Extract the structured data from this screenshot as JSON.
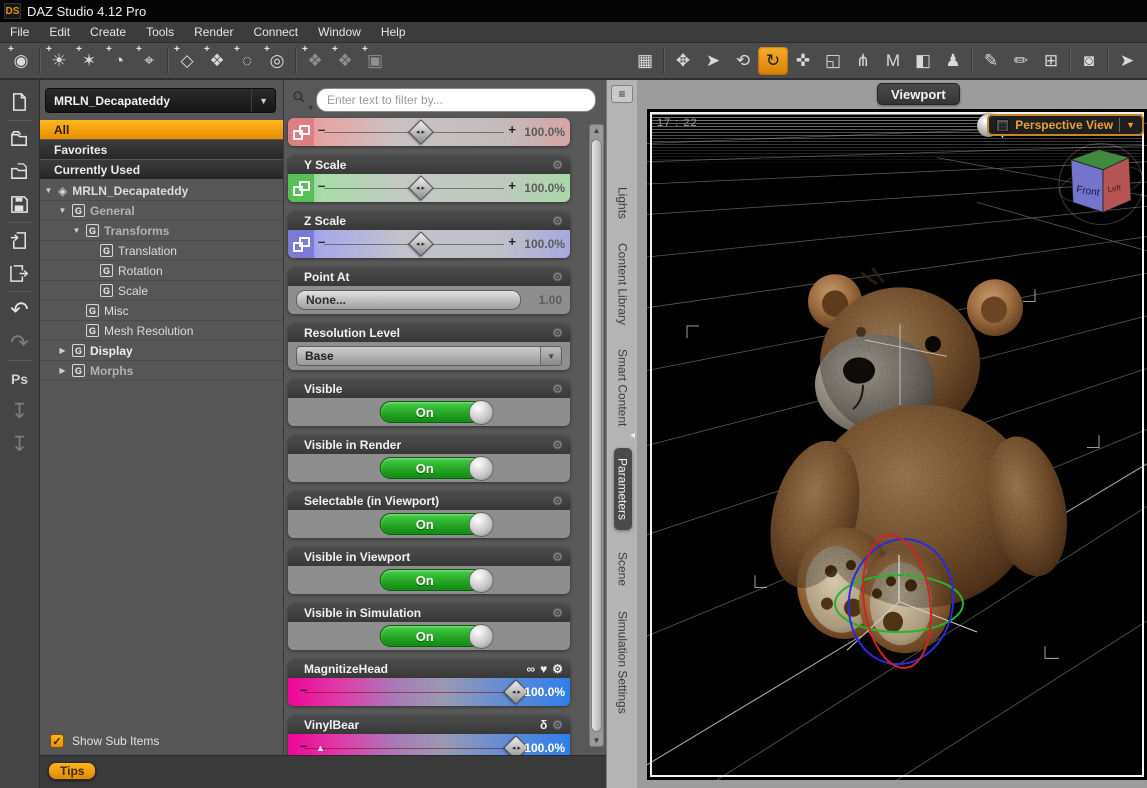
{
  "window": {
    "logo": "DS",
    "title": "DAZ Studio 4.12 Pro"
  },
  "menu": {
    "items": [
      "File",
      "Edit",
      "Create",
      "Tools",
      "Render",
      "Connect",
      "Window",
      "Help"
    ]
  },
  "colors": {
    "accent_orange": "#e8920c",
    "toggle_green": "#21a821",
    "slider_red": "#e08888",
    "slider_green": "#6ecb6e",
    "slider_blue": "#8a8ae2",
    "morph_magenta": "#ee0596",
    "morph_blue": "#2f7fe8"
  },
  "icons": {
    "expanded": "▼",
    "collapsed": "▶",
    "dropdown": "▼",
    "group_g": "G",
    "tree_cube": "◈",
    "check": "✓",
    "gear": "⚙",
    "link": "∞",
    "heart": "♥",
    "follower": "δ",
    "handle_marks": "◂ ▸",
    "splitter": "◂",
    "scroll_hint": "▲",
    "panel_menu": "≡",
    "aspect_grid": "▦",
    "pan_tool": "✥",
    "node_select": "➤",
    "orbit_tool": "⟲",
    "rotate_tool": "↻",
    "translate_tool": "✜",
    "scale_tool": "◱",
    "bone_tool": "⋔",
    "geometry_m": "M",
    "surface_tool": "◧",
    "figure_tool": "♟",
    "node_edit": "✎",
    "geometry_brush": "✏",
    "primitive_edit": "⊞",
    "render_cam": "◙",
    "pointer": "➤",
    "create_camera": "◉",
    "distant_light": "☀",
    "point_light": "✶",
    "linear_light": "◔",
    "spotlight": "⌖",
    "primitive": "◇",
    "node_a": "❖",
    "null_node": "◌",
    "center_point": "◎",
    "node_b": "❖",
    "node_instance": "❖",
    "group_cube": "▣",
    "undo": "↶",
    "redo": "↷",
    "ps": "Ps",
    "install": "↧",
    "scroll_up": "▲",
    "scroll_down": "▼",
    "window_icon": "▦"
  },
  "scene_panel": {
    "node_selector": "MRLN_Decapateddy",
    "filters": [
      "All",
      "Favorites",
      "Currently Used"
    ],
    "active_filter": "All",
    "tree": [
      {
        "label": "MRLN_Decapateddy"
      },
      {
        "label": "General"
      },
      {
        "label": "Transforms"
      },
      {
        "label": "Translation"
      },
      {
        "label": "Rotation"
      },
      {
        "label": "Scale"
      },
      {
        "label": "Misc"
      },
      {
        "label": "Mesh Resolution"
      },
      {
        "label": "Display"
      },
      {
        "label": "Morphs"
      }
    ],
    "show_sub_items": "Show Sub Items",
    "tips": "Tips"
  },
  "parameters_panel": {
    "search_placeholder": "Enter text to filter by...",
    "nudge_minus": "–",
    "nudge_plus": "+",
    "scale_sliders": [
      {
        "label": "",
        "value": "100.0%"
      },
      {
        "label": "Y Scale",
        "value": "100.0%"
      },
      {
        "label": "Z Scale",
        "value": "100.0%"
      }
    ],
    "point_at": {
      "label": "Point At",
      "button": "None...",
      "value": "1.00"
    },
    "resolution": {
      "label": "Resolution Level",
      "value": "Base"
    },
    "toggles": [
      {
        "label": "Visible",
        "state": "On"
      },
      {
        "label": "Visible in Render",
        "state": "On"
      },
      {
        "label": "Selectable (in Viewport)",
        "state": "On"
      },
      {
        "label": "Visible in Viewport",
        "state": "On"
      },
      {
        "label": "Visible in Simulation",
        "state": "On"
      }
    ],
    "morph_sliders": [
      {
        "label": "MagnitizeHead",
        "value": "100.0%"
      },
      {
        "label": "VinylBear",
        "value": "100.0%"
      }
    ]
  },
  "dock_tabs": {
    "items": [
      "Lights",
      "Content Library",
      "Smart Content",
      "Parameters",
      "Scene",
      "Simulation Settings"
    ],
    "active": "Parameters"
  },
  "viewport": {
    "tab": "Viewport",
    "timecode": "17 : 22",
    "camera": "Perspective View",
    "cube_label": "Front",
    "cube_label_right": "Left"
  }
}
